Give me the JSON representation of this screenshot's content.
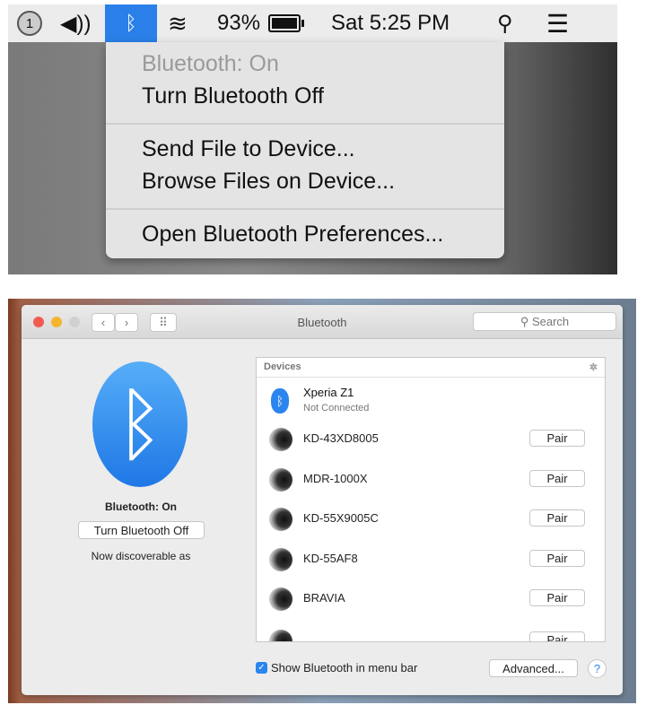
{
  "menubar": {
    "notification_count": "1",
    "battery": "93%",
    "clock": "Sat 5:25 PM"
  },
  "bt_menu": {
    "status": "Bluetooth: On",
    "turn_off": "Turn Bluetooth Off",
    "send_file": "Send File to Device...",
    "browse_files": "Browse Files on Device...",
    "open_prefs": "Open Bluetooth Preferences..."
  },
  "window": {
    "title": "Bluetooth",
    "search_placeholder": "Search"
  },
  "left": {
    "status": "Bluetooth: On",
    "turn_off": "Turn Bluetooth Off",
    "discoverable": "Now discoverable as"
  },
  "devices": {
    "header": "Devices",
    "connected": {
      "name": "Xperia Z1",
      "status": "Not Connected"
    },
    "items": [
      {
        "name": "KD-43XD8005",
        "action": "Pair"
      },
      {
        "name": "MDR-1000X",
        "action": "Pair"
      },
      {
        "name": "KD-55X9005C",
        "action": "Pair"
      },
      {
        "name": "KD-55AF8",
        "action": "Pair"
      },
      {
        "name": "BRAVIA",
        "action": "Pair"
      }
    ],
    "partial_action": "Pair"
  },
  "footer": {
    "show_in_menu_bar": "Show Bluetooth in menu bar",
    "show_checked": true,
    "advanced": "Advanced...",
    "help": "?"
  },
  "colors": {
    "accent": "#2a7fe8"
  }
}
